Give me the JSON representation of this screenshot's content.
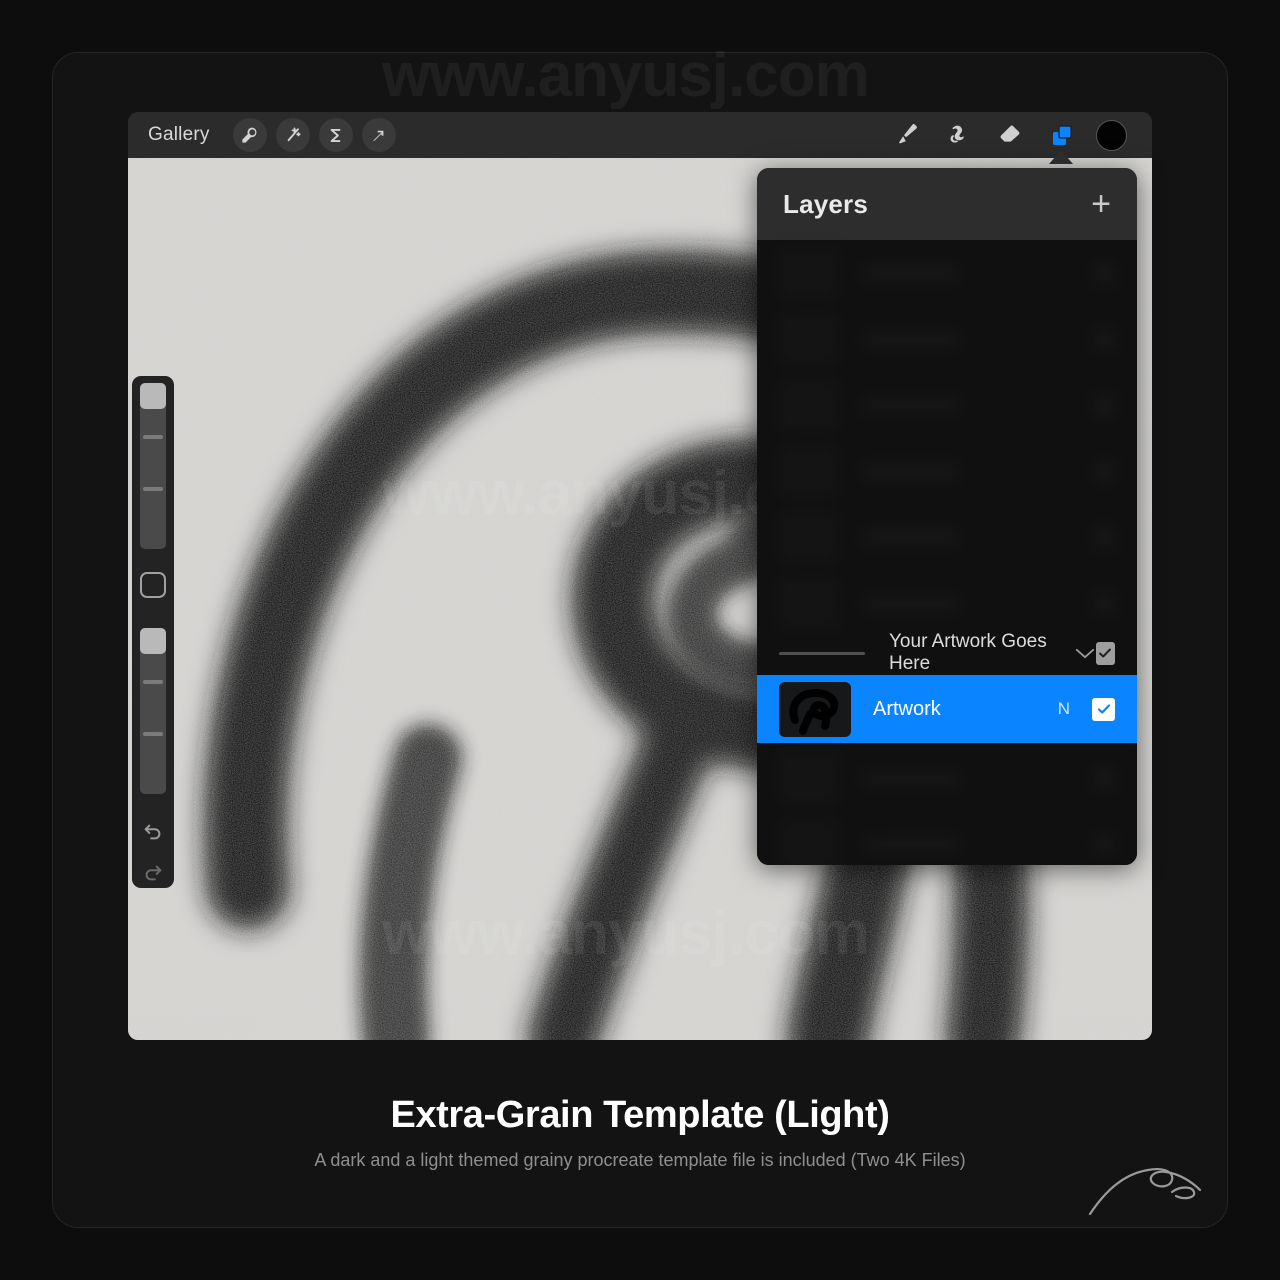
{
  "watermark": {
    "text": "www.anyusj.com",
    "occurrences": 3
  },
  "caption": {
    "title": "Extra-Grain Template (Light)",
    "subtitle": "A dark and a light themed grainy procreate template file is included (Two 4K Files)"
  },
  "signature": {
    "name": "artist-signature"
  },
  "app": {
    "toolbar": {
      "gallery_label": "Gallery",
      "left_tools": [
        {
          "name": "wrench-icon",
          "label": "Actions"
        },
        {
          "name": "magic-wand-icon",
          "label": "Adjustments"
        },
        {
          "name": "selection-s-icon",
          "label": "Selection"
        },
        {
          "name": "arrow-transform-icon",
          "label": "Transform"
        }
      ],
      "right_tools": [
        {
          "name": "paintbrush-icon",
          "label": "Paint",
          "active": false
        },
        {
          "name": "smudge-icon",
          "label": "Smudge",
          "active": false
        },
        {
          "name": "eraser-icon",
          "label": "Erase",
          "active": false
        },
        {
          "name": "layers-icon",
          "label": "Layers",
          "active": true
        }
      ],
      "color_swatch": {
        "name": "color-swatch",
        "color": "#030303"
      },
      "accent_color": "#0a84ff"
    },
    "sidebar": {
      "brush_size_label": "Brush size",
      "brush_opacity_label": "Brush opacity",
      "modify_label": "Modify",
      "undo_label": "Undo",
      "redo_label": "Redo"
    },
    "canvas": {
      "background_color": "#d7d6d3",
      "artwork_description": "grainy black spiral brush lettering"
    },
    "layers_panel": {
      "title": "Layers",
      "add_label": "+",
      "obscured_rows_above": 5,
      "obscured_rows_below": 3,
      "rows": [
        {
          "name": "layer-row-hint",
          "label": "Your Artwork Goes Here",
          "blend_mode": "",
          "visible": true,
          "selected": false,
          "has_chevron": true
        },
        {
          "name": "layer-row-artwork",
          "label": "Artwork",
          "blend_mode": "N",
          "visible": true,
          "selected": true,
          "has_chevron": false
        }
      ]
    }
  }
}
